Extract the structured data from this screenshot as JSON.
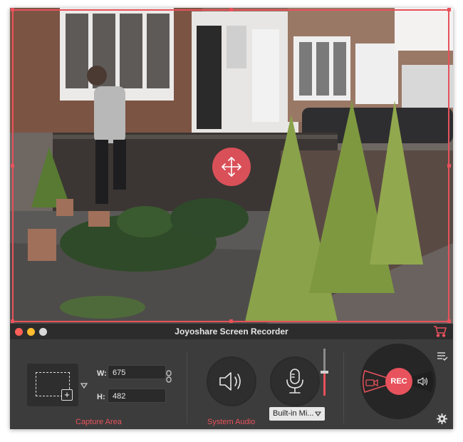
{
  "window": {
    "title": "Joyoshare Screen Recorder"
  },
  "capture_area": {
    "width_label": "W:",
    "width_value": "675",
    "height_label": "H:",
    "height_value": "482",
    "label": "Capture Area"
  },
  "system_audio": {
    "label": "System Audio",
    "volume_level": 0.5
  },
  "microphone": {
    "selected": "Built-in Mi..."
  },
  "record": {
    "label": "REC"
  },
  "colors": {
    "accent": "#e8525c",
    "panel": "#3c3c3c"
  },
  "icons": [
    "close-dot",
    "minimize-dot",
    "zoom-dot",
    "cart-icon",
    "move-icon",
    "dropdown-arrow-icon",
    "link-icon",
    "speaker-icon",
    "microphone-icon",
    "camera-icon",
    "list-icon",
    "gear-icon"
  ]
}
